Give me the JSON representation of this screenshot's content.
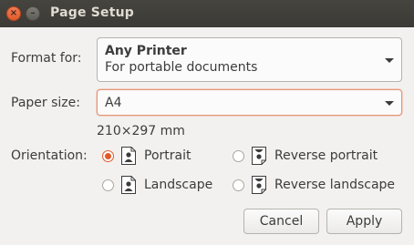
{
  "window": {
    "title": "Page Setup",
    "close_glyph": "×",
    "minimize_glyph": "–"
  },
  "format_for": {
    "label": "Format for:",
    "printer_name": "Any Printer",
    "printer_desc": "For portable documents"
  },
  "paper_size": {
    "label": "Paper size:",
    "value": "A4",
    "dimensions": "210×297 mm"
  },
  "orientation": {
    "label": "Orientation:",
    "options": [
      {
        "label": "Portrait",
        "checked": true,
        "icon": "portrait-page-icon"
      },
      {
        "label": "Reverse portrait",
        "checked": false,
        "icon": "reverse-portrait-page-icon"
      },
      {
        "label": "Landscape",
        "checked": false,
        "icon": "landscape-page-icon"
      },
      {
        "label": "Reverse landscape",
        "checked": false,
        "icon": "reverse-landscape-page-icon"
      }
    ]
  },
  "buttons": {
    "cancel": "Cancel",
    "apply": "Apply"
  },
  "colors": {
    "accent": "#e05a2a",
    "titlebar": "#3f3e39",
    "background": "#f2f1f0"
  }
}
